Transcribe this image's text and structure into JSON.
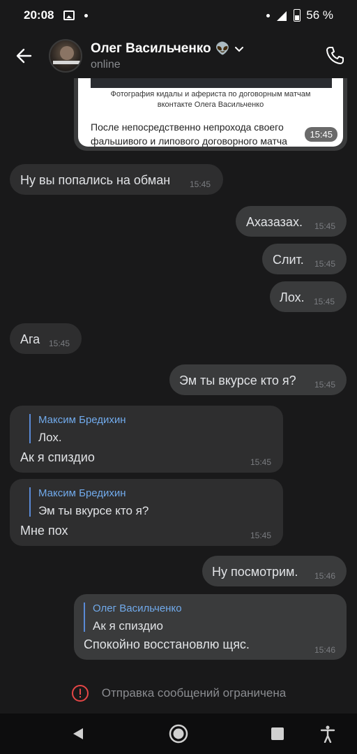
{
  "status": {
    "time": "20:08",
    "battery": "56 %"
  },
  "header": {
    "contact_name": "Олег Васильченко",
    "emoji": "👽",
    "status": "online"
  },
  "preview": {
    "caption_line1": "Фотография кидалы и афериста по договорным матчам",
    "caption_line2": "вконтакте Олега Васильченко",
    "text_line1": "После непосредственно непрохода своего",
    "text_line2": "фальшивого и липового договорного матча",
    "time": "15:45"
  },
  "messages": [
    {
      "direction": "in",
      "text": "Ну вы попались на обман",
      "time": "15:45"
    },
    {
      "direction": "out",
      "text": "Ахазазах.",
      "time": "15:45"
    },
    {
      "direction": "out",
      "text": "Слит.",
      "time": "15:45"
    },
    {
      "direction": "out",
      "text": "Лох.",
      "time": "15:45"
    },
    {
      "direction": "in",
      "text": "Ага",
      "time": "15:45"
    },
    {
      "direction": "out",
      "text": "Эм ты вкурсе кто я?",
      "time": "15:45"
    },
    {
      "direction": "in",
      "reply_author": "Максим Бредихин",
      "reply_text": "Лох.",
      "text": "Ак я спиздио",
      "time": "15:45"
    },
    {
      "direction": "in",
      "reply_author": "Максим Бредихин",
      "reply_text": "Эм ты вкурсе кто я?",
      "text": "Мне пох",
      "time": "15:45"
    },
    {
      "direction": "out",
      "text": "Ну посмотрим.",
      "time": "15:46"
    },
    {
      "direction": "out",
      "reply_author": "Олег Васильченко",
      "reply_text": "Ак я спиздио",
      "text": "Спокойно восстановлю щяс.",
      "time": "15:46"
    }
  ],
  "restriction": {
    "text": "Отправка сообщений ограничена"
  },
  "colors": {
    "background": "#19191a",
    "bubble_in": "#2e2e2f",
    "bubble_out": "#3a3b3c",
    "reply_author": "#71aaeb",
    "warning": "#e64646"
  }
}
